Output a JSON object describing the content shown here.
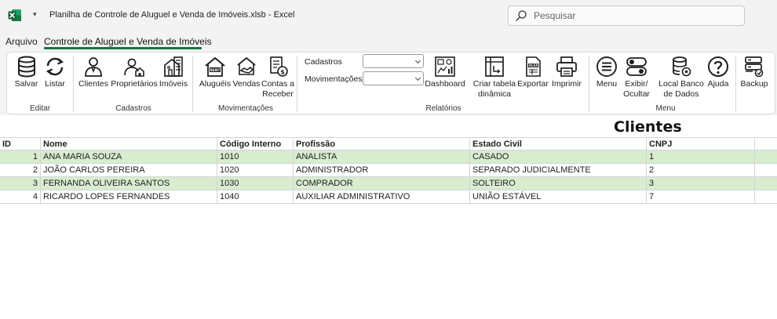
{
  "window": {
    "title": "Planilha de Controle de Aluguel e Venda de Imóveis.xlsb  -  Excel",
    "search_placeholder": "Pesquisar"
  },
  "tabs": [
    {
      "label": "Arquivo"
    },
    {
      "label": "Controle de Aluguel e Venda de Imóveis",
      "active": true
    }
  ],
  "ribbon": {
    "buttons": {
      "salvar": "Salvar",
      "listar": "Listar",
      "clientes": "Clientes",
      "proprietarios": "Proprietários",
      "imoveis": "Imóveis",
      "alugueis": "Aluguéis",
      "vendas": "Vendas",
      "contas_l1": "Contas a",
      "contas_l2": "Receber",
      "dashboard": "Dashboard",
      "criar_l1": "Criar tabela",
      "criar_l2": "dinâmica",
      "exportar": "Exportar",
      "imprimir": "Imprimir",
      "menu": "Menu",
      "exibir_l1": "Exibir/",
      "exibir_l2": "Ocultar",
      "local_l1": "Local Banco",
      "local_l2": "de Dados",
      "ajuda": "Ajuda",
      "backup": "Backup"
    },
    "combos": {
      "cadastros_label": "Cadastros",
      "movimentacoes_label": "Movimentações"
    },
    "groups": {
      "editar": "Editar",
      "cadastros": "Cadastros",
      "movimentacoes": "Movimentações",
      "relatorios": "Relatórios",
      "menu": "Menu"
    },
    "icon_color": "#1f1f1f"
  },
  "sheet": {
    "title": "Clientes",
    "headers": [
      "ID",
      "Nome",
      "Código Interno",
      "Profissão",
      "Estado Civil",
      "CNPJ"
    ],
    "rows": [
      [
        "1",
        "ANA MARIA SOUZA",
        "1010",
        "ANALISTA",
        "CASADO",
        "1"
      ],
      [
        "2",
        "JOÃO CARLOS PEREIRA",
        "1020",
        "ADMINISTRADOR",
        "SEPARADO JUDICIALMENTE",
        "2"
      ],
      [
        "3",
        "FERNANDA OLIVEIRA SANTOS",
        "1030",
        "COMPRADOR",
        "SOLTEIRO",
        "3"
      ],
      [
        "4",
        "RICARDO LOPES FERNANDES",
        "1040",
        "AUXILIAR ADMINISTRATIVO",
        "UNIÃO ESTÁVEL",
        "7"
      ]
    ],
    "band_color": "#d8ecd0"
  },
  "colors": {
    "excel_green": "#1a7343",
    "chrome": "#f3f3f3"
  }
}
